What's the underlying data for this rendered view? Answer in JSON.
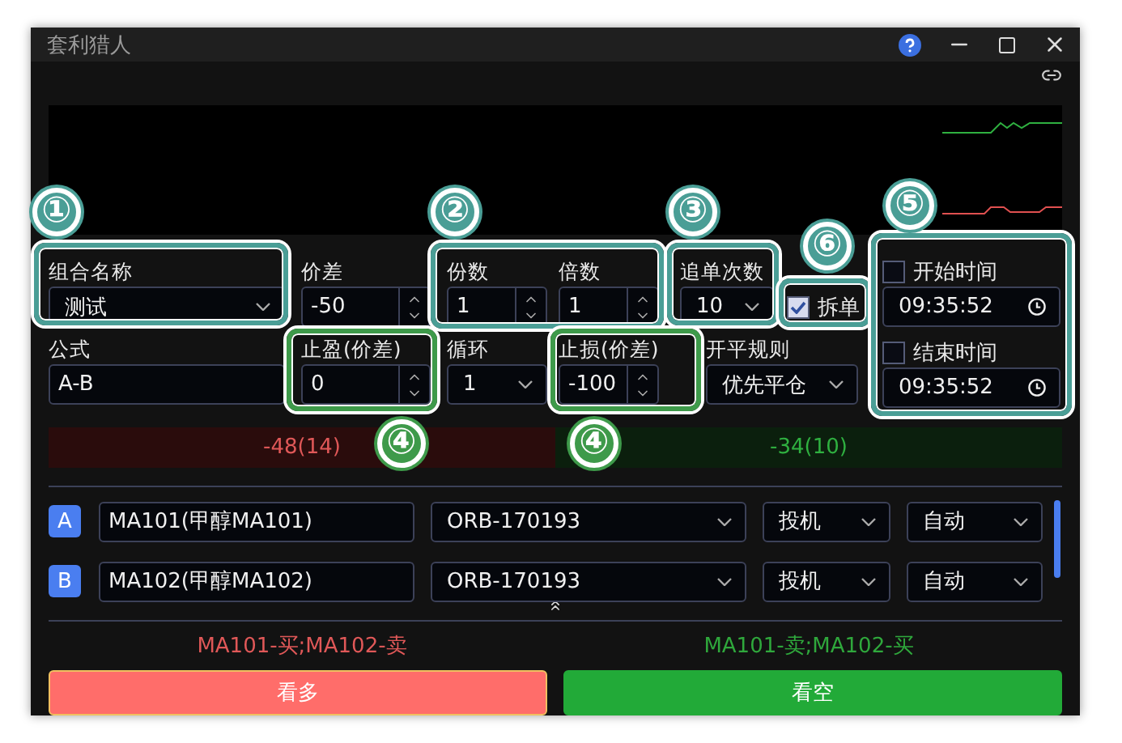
{
  "window": {
    "title": "套利猎人"
  },
  "form": {
    "combo_name": {
      "label": "组合名称",
      "value": "测试"
    },
    "spread": {
      "label": "价差",
      "value": "-50"
    },
    "lots": {
      "label": "份数",
      "value": "1"
    },
    "multiple": {
      "label": "倍数",
      "value": "1"
    },
    "chase_count": {
      "label": "追单次数",
      "value": "10"
    },
    "split": {
      "label": "拆单",
      "checked": true
    },
    "start_time": {
      "label": "开始时间",
      "checked": false,
      "value": "09:35:52"
    },
    "end_time": {
      "label": "结束时间",
      "checked": false,
      "value": "09:35:52"
    },
    "formula": {
      "label": "公式",
      "value": "A-B"
    },
    "take_profit": {
      "label": "止盈(价差)",
      "value": "0"
    },
    "loop": {
      "label": "循环",
      "value": "1"
    },
    "stop_loss": {
      "label": "止损(价差)",
      "value": "-100"
    },
    "open_close_rule": {
      "label": "开平规则",
      "value": "优先平仓"
    }
  },
  "spread_bar": {
    "buy": "-48(14)",
    "sell": "-34(10)"
  },
  "legs": [
    {
      "badge": "A",
      "instrument": "MA101(甲醇MA101)",
      "account": "ORB-170193",
      "hedge": "投机",
      "mode": "自动"
    },
    {
      "badge": "B",
      "instrument": "MA102(甲醇MA102)",
      "account": "ORB-170193",
      "hedge": "投机",
      "mode": "自动"
    }
  ],
  "signals": {
    "long": "MA101-买;MA102-卖",
    "short": "MA101-卖;MA102-买"
  },
  "buttons": [
    {
      "label": "看多",
      "kind": "long"
    },
    {
      "label": "看空",
      "kind": "short"
    }
  ],
  "annotations": [
    {
      "label": "①",
      "color": "#4a9e96"
    },
    {
      "label": "②",
      "color": "#4a9e96"
    },
    {
      "label": "③",
      "color": "#4a9e96"
    },
    {
      "label": "⑥",
      "color": "#4a9e96"
    },
    {
      "label": "⑤",
      "color": "#4a9e96"
    },
    {
      "label": "④",
      "color": "#3e9a4a"
    },
    {
      "label": "④",
      "color": "#3e9a4a"
    }
  ]
}
